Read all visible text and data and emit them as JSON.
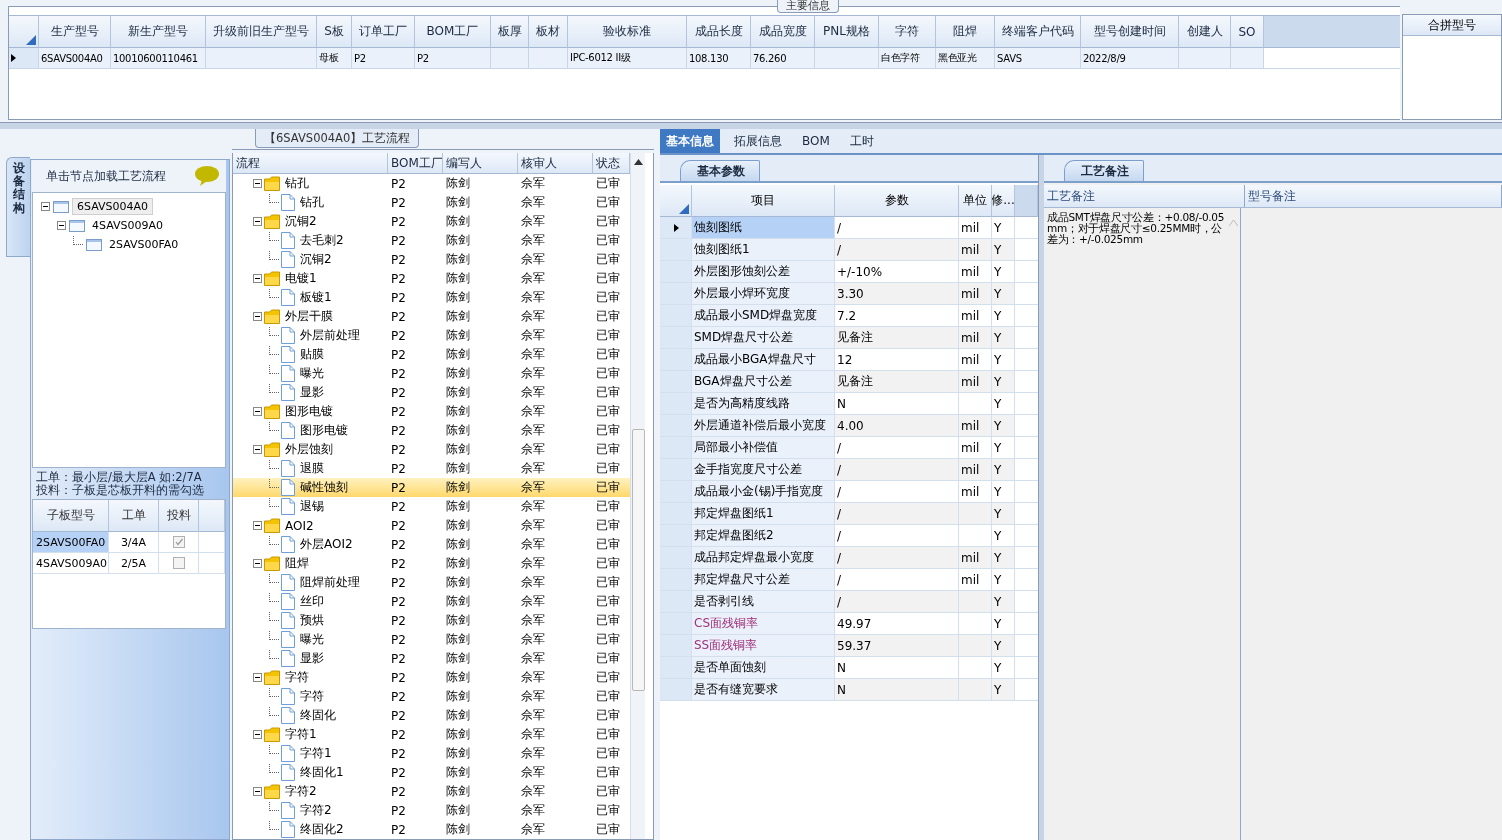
{
  "main_info": {
    "caption": "主要信息",
    "columns": [
      "生产型号",
      "新生产型号",
      "升级前旧生产型号",
      "S板",
      "订单工厂",
      "BOM工厂",
      "板厚",
      "板材",
      "验收标准",
      "成品长度",
      "成品宽度",
      "PNL规格",
      "字符",
      "阻焊",
      "终端客户代码",
      "型号创建时间",
      "创建人",
      "SO"
    ],
    "rows": [
      {
        "current": true,
        "cells": [
          "6SAVS004A0",
          "10010600110461",
          null,
          "母板",
          "P2",
          "P2",
          null,
          null,
          "IPC-6012 II级",
          "108.130",
          "76.260",
          null,
          "白色字符",
          "黑色亚光",
          "SAVS",
          "2022/8/9",
          null,
          null
        ]
      }
    ]
  },
  "merge_panel": {
    "title": "合拼型号"
  },
  "structure_panel": {
    "side_tab": "设备结构",
    "hint": "单击节点加载工艺流程",
    "board_tree": [
      {
        "label": "6SAVS004A0",
        "selected": true,
        "expanded": true,
        "children": [
          {
            "label": "4SAVS009A0",
            "selected": false,
            "expanded": true,
            "children": [
              {
                "label": "2SAVS00FA0",
                "selected": false
              }
            ]
          }
        ]
      }
    ],
    "notes": [
      "工单：最小层/最大层A 如:2/7A",
      "投料：子板是芯板开料的需勾选"
    ],
    "sub_boards": {
      "columns": [
        "子板型号",
        "工单",
        "投料"
      ],
      "rows": [
        {
          "model": "2SAVS00FA0",
          "order": "3/4A",
          "feed": true,
          "selected": true
        },
        {
          "model": "4SAVS009A0",
          "order": "2/5A",
          "feed": false,
          "selected": false
        }
      ]
    }
  },
  "process_flow": {
    "title": "【6SAVS004A0】工艺流程",
    "columns": [
      "流程",
      "BOM工厂",
      "编写人",
      "核审人",
      "状态"
    ],
    "nodes": [
      {
        "name": "钻孔",
        "bom": "P2",
        "writer": "陈剑",
        "reviewer": "佘军",
        "status": "已审",
        "selected": false,
        "expanded": true,
        "children": [
          {
            "name": "钻孔",
            "bom": "P2",
            "writer": "陈剑",
            "reviewer": "佘军",
            "status": "已审",
            "selected": false
          }
        ]
      },
      {
        "name": "沉铜2",
        "bom": "P2",
        "writer": "陈剑",
        "reviewer": "佘军",
        "status": "已审",
        "selected": false,
        "expanded": true,
        "children": [
          {
            "name": "去毛刺2",
            "bom": "P2",
            "writer": "陈剑",
            "reviewer": "佘军",
            "status": "已审",
            "selected": false
          },
          {
            "name": "沉铜2",
            "bom": "P2",
            "writer": "陈剑",
            "reviewer": "佘军",
            "status": "已审",
            "selected": false
          }
        ]
      },
      {
        "name": "电镀1",
        "bom": "P2",
        "writer": "陈剑",
        "reviewer": "佘军",
        "status": "已审",
        "selected": false,
        "expanded": true,
        "children": [
          {
            "name": "板镀1",
            "bom": "P2",
            "writer": "陈剑",
            "reviewer": "佘军",
            "status": "已审",
            "selected": false
          }
        ]
      },
      {
        "name": "外层干膜",
        "bom": "P2",
        "writer": "陈剑",
        "reviewer": "佘军",
        "status": "已审",
        "selected": false,
        "expanded": true,
        "children": [
          {
            "name": "外层前处理",
            "bom": "P2",
            "writer": "陈剑",
            "reviewer": "佘军",
            "status": "已审",
            "selected": false
          },
          {
            "name": "贴膜",
            "bom": "P2",
            "writer": "陈剑",
            "reviewer": "佘军",
            "status": "已审",
            "selected": false
          },
          {
            "name": "曝光",
            "bom": "P2",
            "writer": "陈剑",
            "reviewer": "佘军",
            "status": "已审",
            "selected": false
          },
          {
            "name": "显影",
            "bom": "P2",
            "writer": "陈剑",
            "reviewer": "佘军",
            "status": "已审",
            "selected": false
          }
        ]
      },
      {
        "name": "图形电镀",
        "bom": "P2",
        "writer": "陈剑",
        "reviewer": "佘军",
        "status": "已审",
        "selected": false,
        "expanded": true,
        "children": [
          {
            "name": "图形电镀",
            "bom": "P2",
            "writer": "陈剑",
            "reviewer": "佘军",
            "status": "已审",
            "selected": false
          }
        ]
      },
      {
        "name": "外层蚀刻",
        "bom": "P2",
        "writer": "陈剑",
        "reviewer": "佘军",
        "status": "已审",
        "selected": false,
        "expanded": true,
        "children": [
          {
            "name": "退膜",
            "bom": "P2",
            "writer": "陈剑",
            "reviewer": "佘军",
            "status": "已审",
            "selected": false
          },
          {
            "name": "碱性蚀刻",
            "bom": "P2",
            "writer": "陈剑",
            "reviewer": "佘军",
            "status": "已审",
            "selected": true
          },
          {
            "name": "退锡",
            "bom": "P2",
            "writer": "陈剑",
            "reviewer": "佘军",
            "status": "已审",
            "selected": false
          }
        ]
      },
      {
        "name": "AOI2",
        "bom": "P2",
        "writer": "陈剑",
        "reviewer": "佘军",
        "status": "已审",
        "selected": false,
        "expanded": true,
        "children": [
          {
            "name": "外层AOI2",
            "bom": "P2",
            "writer": "陈剑",
            "reviewer": "佘军",
            "status": "已审",
            "selected": false
          }
        ]
      },
      {
        "name": "阻焊",
        "bom": "P2",
        "writer": "陈剑",
        "reviewer": "佘军",
        "status": "已审",
        "selected": false,
        "expanded": true,
        "children": [
          {
            "name": "阻焊前处理",
            "bom": "P2",
            "writer": "陈剑",
            "reviewer": "佘军",
            "status": "已审",
            "selected": false
          },
          {
            "name": "丝印",
            "bom": "P2",
            "writer": "陈剑",
            "reviewer": "佘军",
            "status": "已审",
            "selected": false
          },
          {
            "name": "预烘",
            "bom": "P2",
            "writer": "陈剑",
            "reviewer": "佘军",
            "status": "已审",
            "selected": false
          },
          {
            "name": "曝光",
            "bom": "P2",
            "writer": "陈剑",
            "reviewer": "佘军",
            "status": "已审",
            "selected": false
          },
          {
            "name": "显影",
            "bom": "P2",
            "writer": "陈剑",
            "reviewer": "佘军",
            "status": "已审",
            "selected": false
          }
        ]
      },
      {
        "name": "字符",
        "bom": "P2",
        "writer": "陈剑",
        "reviewer": "佘军",
        "status": "已审",
        "selected": false,
        "expanded": true,
        "children": [
          {
            "name": "字符",
            "bom": "P2",
            "writer": "陈剑",
            "reviewer": "佘军",
            "status": "已审",
            "selected": false
          },
          {
            "name": "终固化",
            "bom": "P2",
            "writer": "陈剑",
            "reviewer": "佘军",
            "status": "已审",
            "selected": false
          }
        ]
      },
      {
        "name": "字符1",
        "bom": "P2",
        "writer": "陈剑",
        "reviewer": "佘军",
        "status": "已审",
        "selected": false,
        "expanded": true,
        "children": [
          {
            "name": "字符1",
            "bom": "P2",
            "writer": "陈剑",
            "reviewer": "佘军",
            "status": "已审",
            "selected": false
          },
          {
            "name": "终固化1",
            "bom": "P2",
            "writer": "陈剑",
            "reviewer": "佘军",
            "status": "已审",
            "selected": false
          }
        ]
      },
      {
        "name": "字符2",
        "bom": "P2",
        "writer": "陈剑",
        "reviewer": "佘军",
        "status": "已审",
        "selected": false,
        "expanded": true,
        "children": [
          {
            "name": "字符2",
            "bom": "P2",
            "writer": "陈剑",
            "reviewer": "佘军",
            "status": "已审",
            "selected": false
          },
          {
            "name": "终固化2",
            "bom": "P2",
            "writer": "陈剑",
            "reviewer": "佘军",
            "status": "已审",
            "selected": false
          }
        ]
      }
    ]
  },
  "tabs": [
    {
      "label": "基本信息",
      "selected": true
    },
    {
      "label": "拓展信息",
      "selected": false
    },
    {
      "label": "BOM",
      "selected": false
    },
    {
      "label": "工时",
      "selected": false
    }
  ],
  "basic_params": {
    "tab": "基本参数",
    "columns": [
      "项目",
      "参数",
      "单位",
      "修..."
    ],
    "rows": [
      {
        "item": "蚀刻图纸",
        "value": "/",
        "unit": "mil",
        "modified": "Y",
        "selected": true,
        "flagged": false
      },
      {
        "item": "蚀刻图纸1",
        "value": "/",
        "unit": "mil",
        "modified": "Y",
        "selected": false,
        "flagged": false
      },
      {
        "item": "外层图形蚀刻公差",
        "value": "+/-10%",
        "unit": "mil",
        "modified": "Y",
        "selected": false,
        "flagged": false
      },
      {
        "item": "外层最小焊环宽度",
        "value": "3.30",
        "unit": "mil",
        "modified": "Y",
        "selected": false,
        "flagged": false
      },
      {
        "item": "成品最小SMD焊盘宽度",
        "value": "7.2",
        "unit": "mil",
        "modified": "Y",
        "selected": false,
        "flagged": false
      },
      {
        "item": "SMD焊盘尺寸公差",
        "value": "见备注",
        "unit": "mil",
        "modified": "Y",
        "selected": false,
        "flagged": false
      },
      {
        "item": "成品最小BGA焊盘尺寸",
        "value": "12",
        "unit": "mil",
        "modified": "Y",
        "selected": false,
        "flagged": false
      },
      {
        "item": "BGA焊盘尺寸公差",
        "value": "见备注",
        "unit": "mil",
        "modified": "Y",
        "selected": false,
        "flagged": false
      },
      {
        "item": "是否为高精度线路",
        "value": "N",
        "unit": null,
        "modified": "Y",
        "selected": false,
        "flagged": false
      },
      {
        "item": "外层通道补偿后最小宽度",
        "value": "4.00",
        "unit": "mil",
        "modified": "Y",
        "selected": false,
        "flagged": false
      },
      {
        "item": "局部最小补偿值",
        "value": "/",
        "unit": "mil",
        "modified": "Y",
        "selected": false,
        "flagged": false
      },
      {
        "item": "金手指宽度尺寸公差",
        "value": "/",
        "unit": "mil",
        "modified": "Y",
        "selected": false,
        "flagged": false
      },
      {
        "item": "成品最小金(锡)手指宽度",
        "value": "/",
        "unit": "mil",
        "modified": "Y",
        "selected": false,
        "flagged": false
      },
      {
        "item": "邦定焊盘图纸1",
        "value": "/",
        "unit": null,
        "modified": "Y",
        "selected": false,
        "flagged": false
      },
      {
        "item": "邦定焊盘图纸2",
        "value": "/",
        "unit": null,
        "modified": "Y",
        "selected": false,
        "flagged": false
      },
      {
        "item": "成品邦定焊盘最小宽度",
        "value": "/",
        "unit": "mil",
        "modified": "Y",
        "selected": false,
        "flagged": false
      },
      {
        "item": "邦定焊盘尺寸公差",
        "value": "/",
        "unit": "mil",
        "modified": "Y",
        "selected": false,
        "flagged": false
      },
      {
        "item": "是否剥引线",
        "value": "/",
        "unit": null,
        "modified": "Y",
        "selected": false,
        "flagged": false
      },
      {
        "item": "CS面残铜率",
        "value": "49.97",
        "unit": null,
        "modified": "Y",
        "selected": false,
        "flagged": true
      },
      {
        "item": "SS面残铜率",
        "value": "59.37",
        "unit": null,
        "modified": "Y",
        "selected": false,
        "flagged": true
      },
      {
        "item": "是否单面蚀刻",
        "value": "N",
        "unit": null,
        "modified": "Y",
        "selected": false,
        "flagged": false
      },
      {
        "item": "是否有缝宽要求",
        "value": "N",
        "unit": null,
        "modified": "Y",
        "selected": false,
        "flagged": false
      }
    ]
  },
  "process_remarks": {
    "tab": "工艺备注",
    "columns": [
      "工艺备注",
      "型号备注"
    ],
    "remark": "成品SMT焊盘尺寸公差：+0.08/-0.05mm；对于焊盘尺寸≤0.25MM时，公差为：+/-0.025mm"
  }
}
